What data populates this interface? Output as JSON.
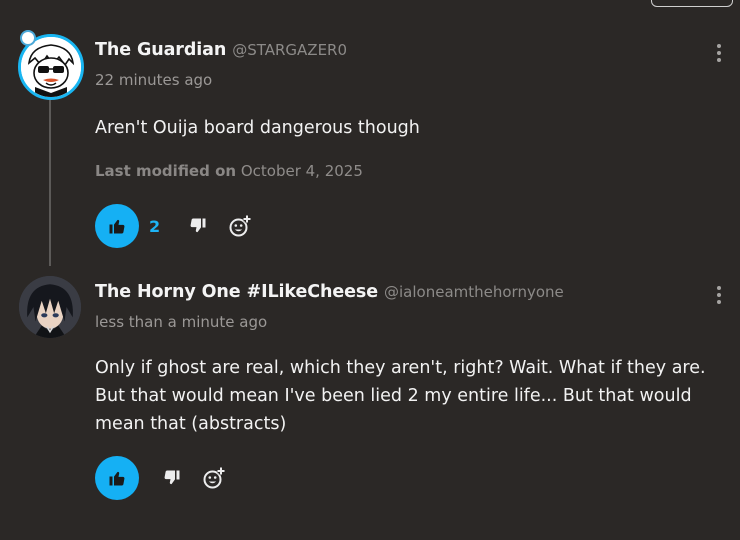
{
  "colors": {
    "background": "#2b2826",
    "accent": "#15b0f4",
    "muted_text": "#8f8c8a"
  },
  "comments": [
    {
      "display_name": "The Guardian",
      "username": "@STARGAZER0",
      "timestamp": "22 minutes ago",
      "body": "Aren't Ouija board dangerous though",
      "modified_label": "Last modified on",
      "modified_date": "October 4, 2025",
      "like_count": "2",
      "avatar_icon": "cartoon-avatar-icon",
      "liked": true
    },
    {
      "display_name": "The Horny One #ILikeCheese",
      "username": "@ialoneamthehornyone",
      "timestamp": "less than a minute ago",
      "body": "Only if ghost are real, which they aren't, right? Wait. What if they are. But that would mean I've been lied 2 my entire life... But that would mean that (abstracts)",
      "avatar_icon": "anime-avatar-icon",
      "liked": true
    }
  ]
}
